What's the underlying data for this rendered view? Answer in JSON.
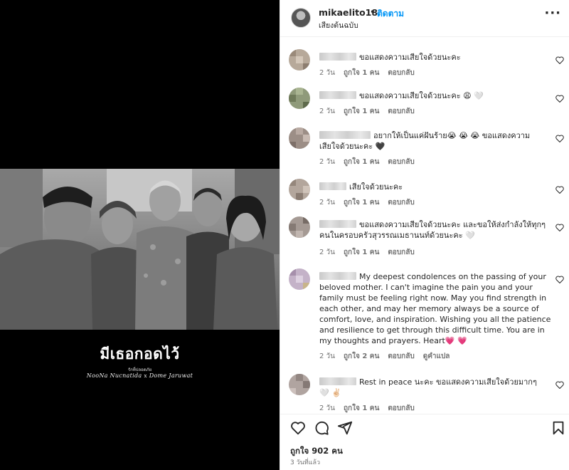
{
  "media": {
    "song_title": "มีเธอกอดไว้",
    "song_subtitle": "รักที่ปลอดภัย",
    "credit_artist_1": "NooNa Nucnatida",
    "credit_x": "x",
    "credit_artist_2": "Dome Jaruwat"
  },
  "header": {
    "username": "mikaelito18",
    "dot": "•",
    "follow_label": "ติดตาม",
    "audio_label": "เสียงต้นฉบับ",
    "more_label": "···"
  },
  "comments": [
    {
      "text": "ขอแสดงความเสียใจด้วยนะคะ",
      "time": "2 วัน",
      "likes": "ถูกใจ 1 คน",
      "reply": "ตอบกลับ"
    },
    {
      "text": "ขอแสดงความเสียใจด้วยนะคะ 😩 🤍",
      "time": "2 วัน",
      "likes": "ถูกใจ 1 คน",
      "reply": "ตอบกลับ"
    },
    {
      "text": "อยากให้เป็นแค่ฝันร้าย😭 😭 😭  ขอแสดงความเสียใจด้วยนะคะ 🖤",
      "time": "2 วัน",
      "likes": "ถูกใจ 1 คน",
      "reply": "ตอบกลับ"
    },
    {
      "text": "เสียใจด้วยนะคะ",
      "time": "2 วัน",
      "likes": "ถูกใจ 1 คน",
      "reply": "ตอบกลับ"
    },
    {
      "text": "ขอแสดงความเสียใจด้วยนะคะ และขอให้ส่งกำลังให้ทุกๆคนในครอบครัวสุวรรณเมธานนท์ด้วยนะคะ 🤍",
      "time": "2 วัน",
      "likes": "ถูกใจ 1 คน",
      "reply": "ตอบกลับ"
    },
    {
      "text": "My deepest condolences on the passing of your beloved mother. I can't imagine the pain you and your family must be feeling right now. May you find strength in each other, and may her memory always be a source of comfort, love, and inspiration. Wishing you all the patience and resilience to get through this difficult time. You are in my thoughts and prayers. Heart💗 💗",
      "time": "2 วัน",
      "likes": "ถูกใจ 2 คน",
      "reply": "ตอบกลับ",
      "translate": "ดูคำแปล"
    },
    {
      "text": "Rest in peace นะคะ ขอแสดงความเสียใจด้วยมากๆ 🤍 ✌🏻",
      "time": "2 วัน",
      "likes": "ถูกใจ 1 คน",
      "reply": "ตอบกลับ"
    }
  ],
  "footer": {
    "likes_label": "ถูกใจ 902 คน",
    "time_label": "3 วันที่แล้ว"
  },
  "icons": {
    "like": "heart-icon",
    "comment": "comment-icon",
    "share": "paper-plane-icon",
    "save": "bookmark-icon"
  },
  "colors": {
    "accent": "#0095f6",
    "muted": "#737373",
    "text": "#262626"
  }
}
